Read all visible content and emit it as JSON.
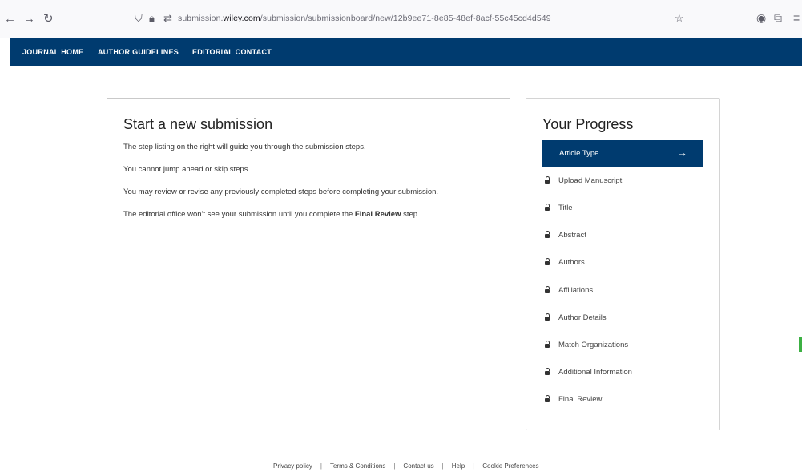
{
  "browser": {
    "url_prefix": "submission.",
    "url_domain": "wiley.com",
    "url_path": "/submission/submissionboard/new/12b9ee71-8e85-48ef-8acf-55c45cd4d549",
    "icons": [
      "back-arrow-icon",
      "forward-arrow-icon",
      "reload-icon",
      "shield-icon",
      "lock-icon",
      "permissions-icon",
      "star-icon",
      "account-icon",
      "extensions-icon",
      "menu-icon"
    ]
  },
  "journal_nav": {
    "items": [
      "JOURNAL HOME",
      "AUTHOR GUIDELINES",
      "EDITORIAL CONTACT"
    ]
  },
  "main": {
    "title": "Start a new submission",
    "paragraphs": [
      "The step listing on the right will guide you through the submission steps.",
      "You cannot jump ahead or skip steps.",
      "You may review or revise any previously completed steps before completing your submission."
    ],
    "last_paragraph_start": "The editorial office won't see your submission until you complete the ",
    "last_paragraph_bold": "Final Review",
    "last_paragraph_end": " step."
  },
  "progress": {
    "title": "Your Progress",
    "active_step": "Article Type",
    "steps": [
      "Upload Manuscript",
      "Title",
      "Abstract",
      "Authors",
      "Affiliations",
      "Author Details",
      "Match Organizations",
      "Additional Information",
      "Final Review"
    ]
  },
  "footer": {
    "links": [
      "Privacy policy",
      "Terms & Conditions",
      "Contact us",
      "Help",
      "Cookie Preferences"
    ]
  },
  "colors": {
    "brand_navy": "#003b6f"
  }
}
